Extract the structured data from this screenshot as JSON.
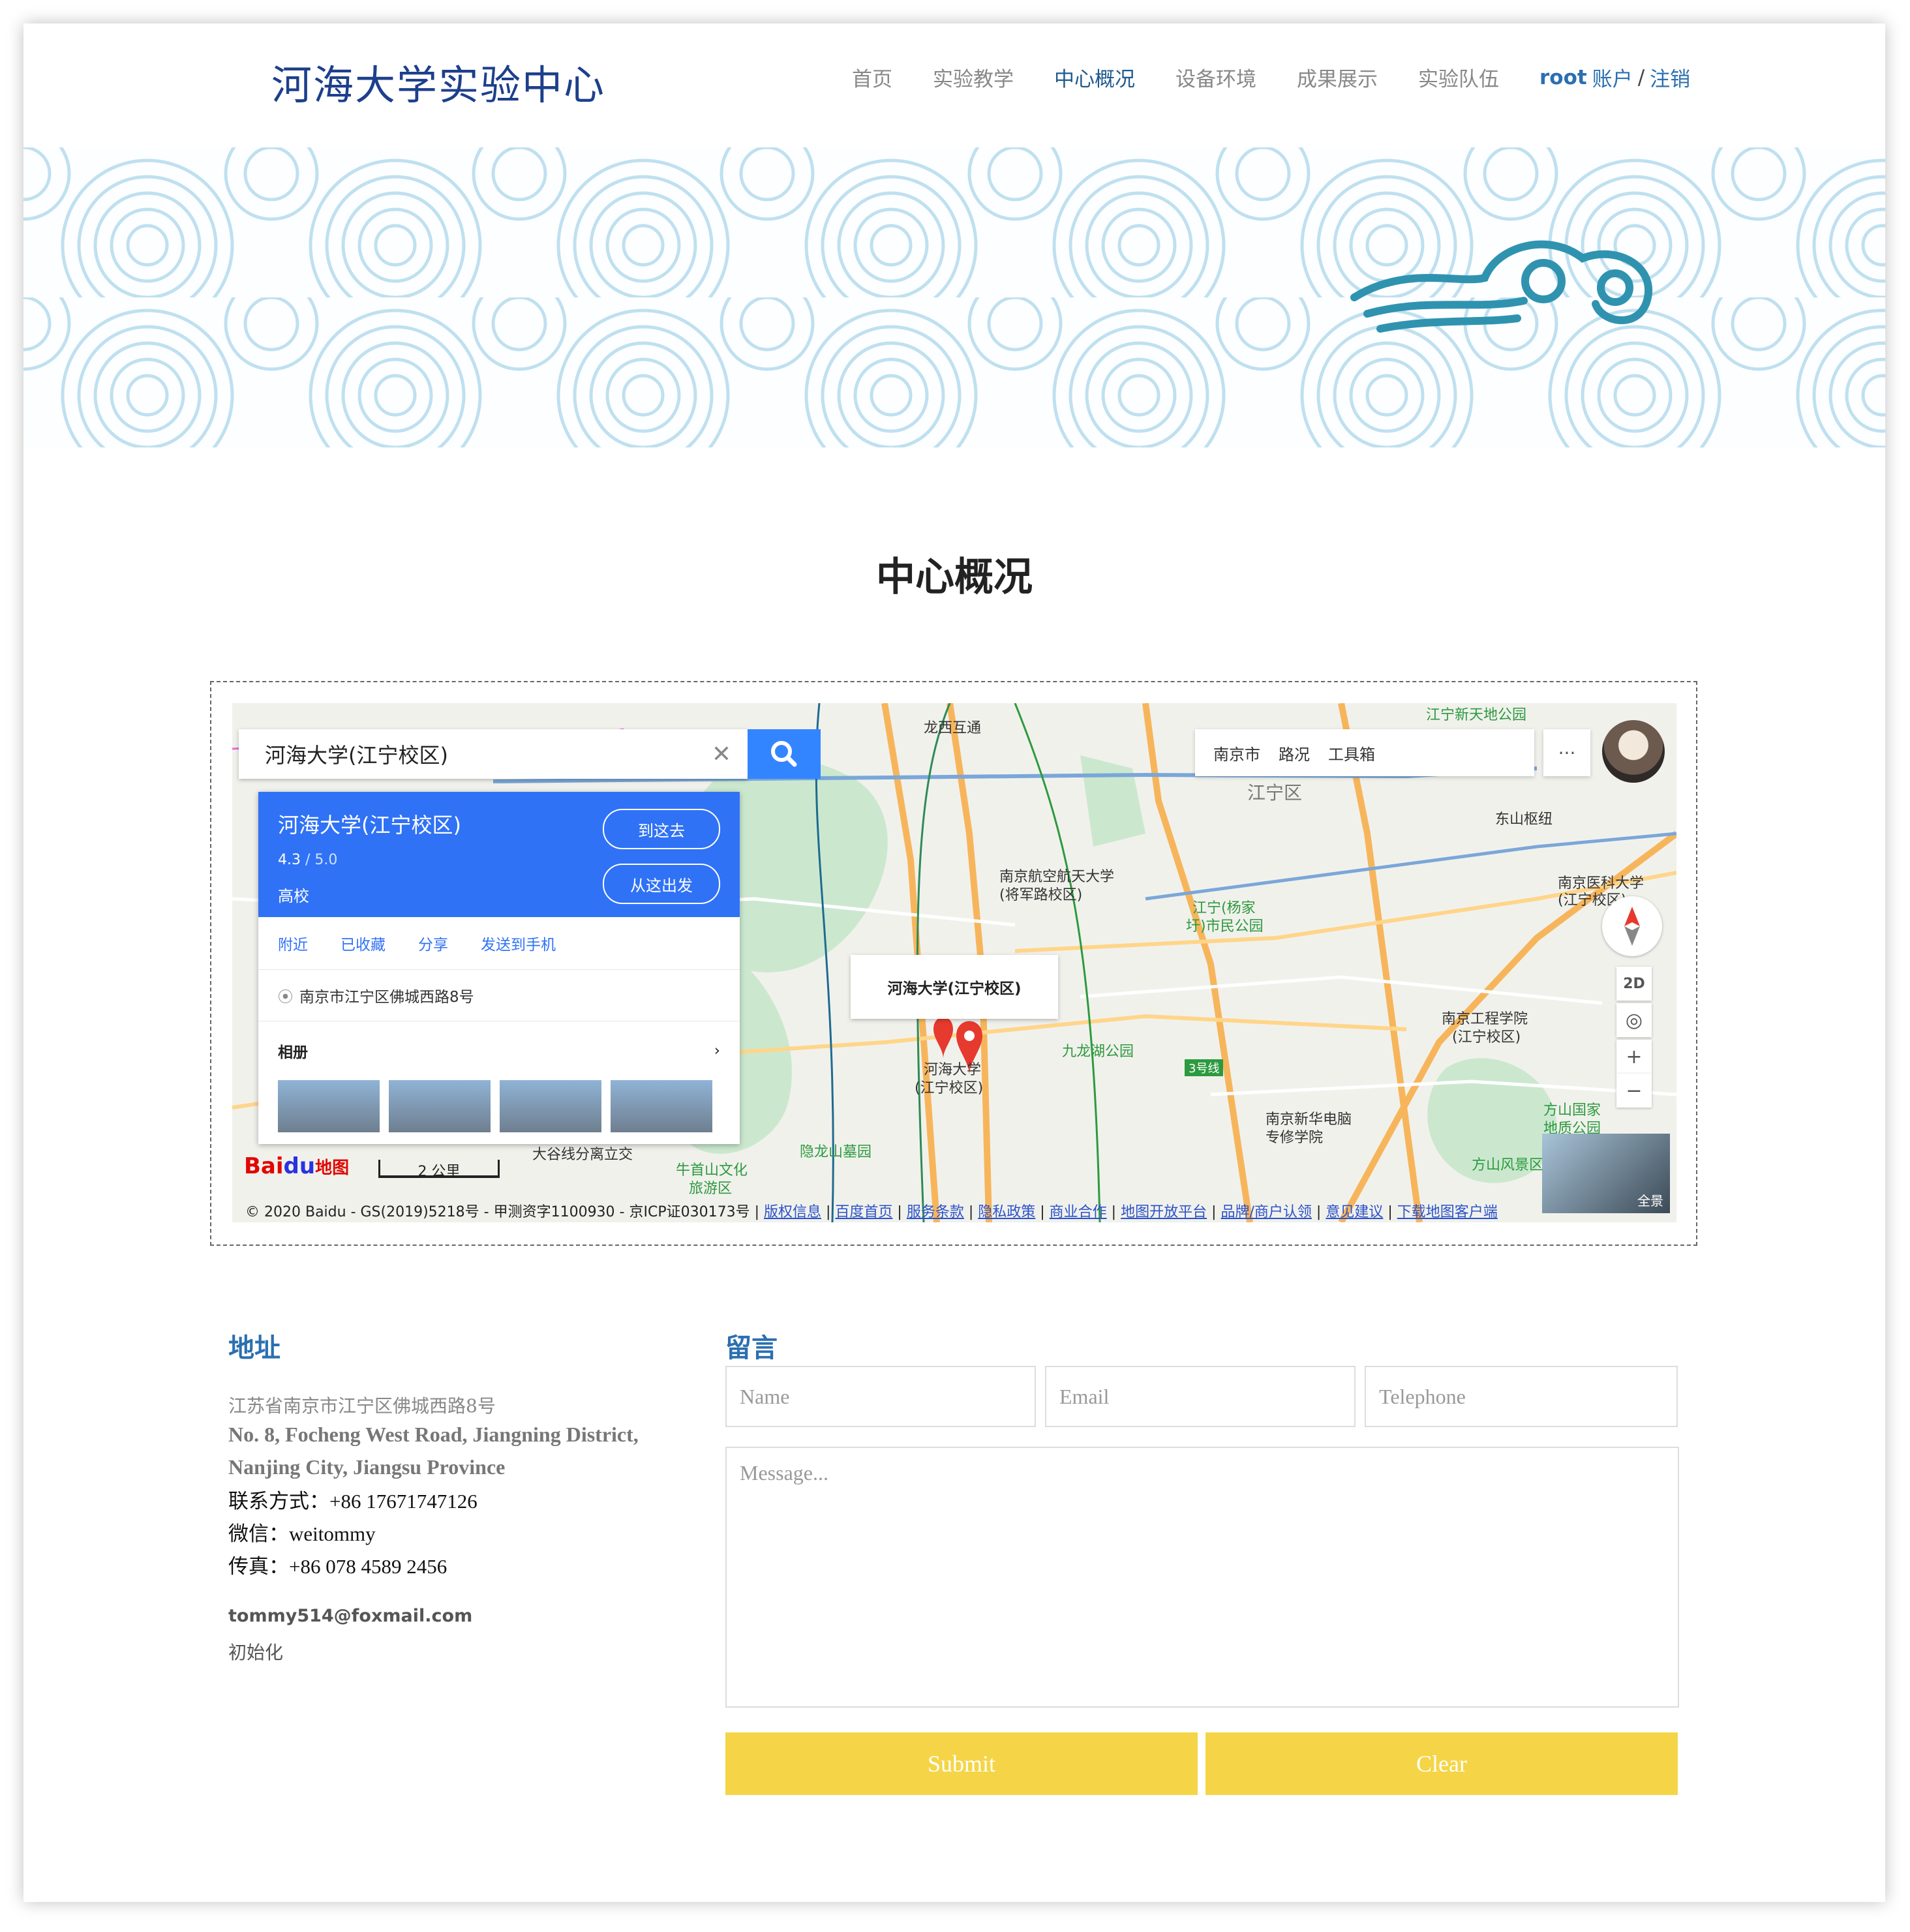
{
  "brand": "河海大学实验中心",
  "nav": {
    "items": [
      "首页",
      "实验教学",
      "中心概况",
      "设备环境",
      "成果展示",
      "实验队伍"
    ],
    "active": "中心概况",
    "account_user": "root",
    "account_label": "账户",
    "separator": "/",
    "logout": "注销"
  },
  "page_title": "中心概况",
  "map": {
    "search_value": "河海大学(江宁校区)",
    "card": {
      "name": "河海大学(江宁校区)",
      "rating": "4.3",
      "rating_max": "/ 5.0",
      "category": "高校",
      "go_here": "到这去",
      "from_here": "从这出发",
      "actions": [
        "附近",
        "已收藏",
        "分享",
        "发送到手机"
      ],
      "address": "南京市江宁区佛城西路8号",
      "album": "相册"
    },
    "toolbar": {
      "city": "南京市",
      "traffic": "路况",
      "tools": "工具箱"
    },
    "tip_title": "河海大学(江宁校区)",
    "marker_label_1": "河海大学",
    "marker_label_2": "(江宁校区)",
    "labels": {
      "l1": "龙西互通",
      "l2": "江宁区",
      "l3": "东山枢纽",
      "l4": "南京航空航天大学",
      "l5": "(将军路校区)",
      "l6": "江宁(杨家",
      "l7": "圩)市民公园",
      "l8": "南京医科大学",
      "l9": "(江宁校区)",
      "l10": "九龙湖公园",
      "l11": "南京工程学院",
      "l12": "(江宁校区)",
      "l13": "南京新华电脑",
      "l14": "专修学院",
      "l15": "方山国家",
      "l16": "地质公园",
      "l17": "方山风景区",
      "l18": "隐龙山墓园",
      "l19": "牛首山文化",
      "l20": "旅游区",
      "l21": "大谷线分离立交",
      "l22": "江宁新天地公园",
      "l23": "3号线"
    },
    "ctrl_2d": "2D",
    "zoom_in": "+",
    "zoom_out": "−",
    "pano_label": "全景",
    "scale": "2 公里",
    "logo_bai": "Bai",
    "logo_du": "du",
    "logo_map": "地图",
    "copyright": "© 2020 Baidu - GS(2019)5218号 - 甲测资字1100930 - 京ICP证030173号",
    "footer_links": [
      "版权信息",
      "百度首页",
      "服务条款",
      "隐私政策",
      "商业合作",
      "地图开放平台",
      "品牌/商户认领",
      "意见建议",
      "下载地图客户端"
    ]
  },
  "address": {
    "title": "地址",
    "cn": "江苏省南京市江宁区佛城西路8号",
    "en": "No. 8, Focheng West Road, Jiangning District, Nanjing City, Jiangsu Province",
    "phone": "联系方式：+86 17671747126",
    "wechat": "微信：weitommy",
    "fax": "传真：+86 078 4589 2456",
    "email": "tommy514@foxmail.com",
    "init": "初始化"
  },
  "message": {
    "title": "留言",
    "name_placeholder": "Name",
    "email_placeholder": "Email",
    "phone_placeholder": "Telephone",
    "message_placeholder": "Message...",
    "submit": "Submit",
    "clear": "Clear"
  }
}
